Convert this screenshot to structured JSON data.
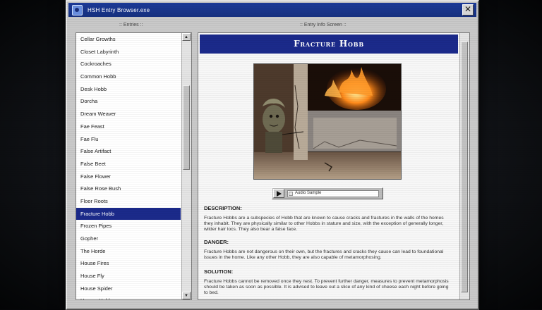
{
  "window": {
    "title": "HSH Entry Browser.exe",
    "close_glyph": "✕"
  },
  "entries_pane": {
    "header": ":: Entries ::",
    "items": [
      "Cellar Growths",
      "Closet Labyrinth",
      "Cockroaches",
      "Common Hobb",
      "Desk Hobb",
      "Dorcha",
      "Dream Weaver",
      "Fae Feast",
      "Fae Flu",
      "False Artifact",
      "False Beet",
      "False Flower",
      "False Rose Bush",
      "Floor Roots",
      "Fracture Hobb",
      "Frozen Pipes",
      "Gopher",
      "The Horde",
      "House Fires",
      "House Fly",
      "House Spider",
      "Hungry Hobb"
    ],
    "selected_index": 14,
    "scroll_up": "▲",
    "scroll_down": "▼"
  },
  "info_pane": {
    "header": ":: Entry Info Screen ::",
    "title": "Fracture Hobb",
    "audio_label": "Audio Sample",
    "sections": [
      {
        "heading": "DESCRIPTION:",
        "text": "Fracture Hobbs are a subspecies of Hobb that are known to cause cracks and fractures in the walls of the homes they inhabit. They are physically similar to other Hobbs in stature and size, with the exception of generally longer, wilder hair locs. They also bear a false face."
      },
      {
        "heading": "DANGER:",
        "text": "Fracture Hobbs are not dangerous on their own, but the fractures and cracks they cause can lead to foundational issues in the home. Like any other Hobb, they are also capable of metamorphosing."
      },
      {
        "heading": "SOLUTION:",
        "text": "Fracture Hobbs cannot be removed once they nest. To prevent further danger, measures to prevent metamorphosis should be taken as soon as possible. It is advised to leave out a slice of any kind of cheese each night before going to bed."
      }
    ]
  },
  "colors": {
    "titlebar": "#1c3a98",
    "selection": "#1b2a8a",
    "window_face": "#c9c9c9"
  }
}
